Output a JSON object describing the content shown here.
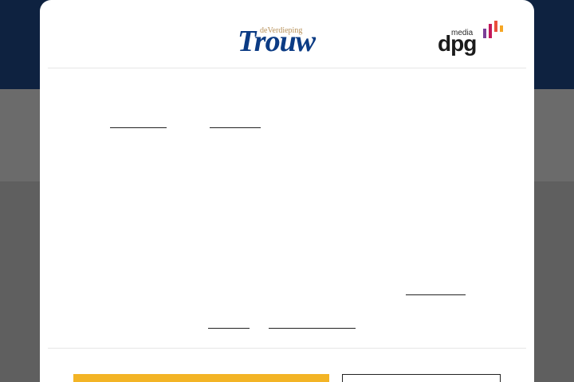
{
  "brand": {
    "trouw_tagline": "deVerdieping",
    "trouw_name": "Trouw",
    "dpg_small": "media",
    "dpg_name": "dpg",
    "dpg_bar_colors": [
      "#7b3f98",
      "#c2185b",
      "#e94e3c",
      "#f6a623"
    ]
  },
  "colors": {
    "header_bg": "#0e2240",
    "overlay": "#5f5f5f",
    "accept_button": "#f3b425",
    "trouw_blue": "#0b3b84"
  },
  "consent": {
    "links": [
      "",
      "",
      "",
      "",
      ""
    ],
    "accept_label": "",
    "settings_label": ""
  }
}
